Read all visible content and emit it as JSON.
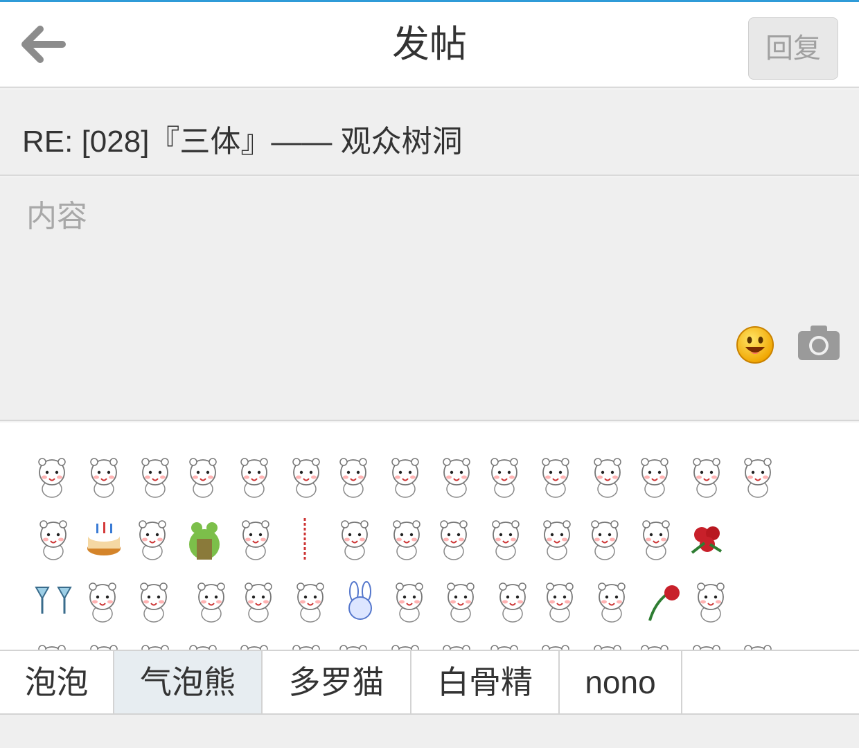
{
  "header": {
    "title": "发帖",
    "back_icon": "arrow-left-icon",
    "reply_label": "回复"
  },
  "subject": {
    "text": "RE: [028]『三体』—— 观众树洞"
  },
  "content": {
    "placeholder": "内容",
    "value": "",
    "emoji_icon": "smiley-face-icon",
    "camera_icon": "camera-icon"
  },
  "stickers": {
    "rows": [
      [
        "bear-laugh",
        "bear-hug",
        "bear-angel-trumpet",
        "bear-cry",
        "bear-sunglasses",
        "bear-shy",
        "bear-halo-dizzy",
        "bear-sulk",
        "bear-angry",
        "bear-stare",
        "bear-bath",
        "bear-tub",
        "bear-giggle",
        "bear-blush",
        "bear-worried"
      ],
      [
        "bear-heart",
        "cake",
        "bear-flower",
        "frog-hood",
        "bear-scared",
        "hanging-rope",
        "bear-santa",
        "bear-blank-face",
        "bear-love-letter",
        "bear-group",
        "bear-standing",
        "bear-happy",
        "bear-smile",
        "rose-bouquet"
      ],
      [
        "cocktail-toast",
        "bear-flower-necklace",
        "bear-sleepy",
        "bear-pair-whisper",
        "bear-pair-peek",
        "bear-incense",
        "bunny-face",
        "bear-peek",
        "bear-cheer",
        "bear-bowl",
        "bear-blush-smile",
        "bear-exclaim",
        "wilted-rose",
        "bear-float"
      ]
    ]
  },
  "tabs": [
    {
      "label": "泡泡",
      "active": false
    },
    {
      "label": "气泡熊",
      "active": true
    },
    {
      "label": "多罗猫",
      "active": false
    },
    {
      "label": "白骨精",
      "active": false
    },
    {
      "label": "nono",
      "active": false
    }
  ],
  "colors": {
    "accent_line": "#2f9bd8",
    "active_tab": "#e7edf1",
    "reply_button_bg": "#e8e8e8"
  }
}
